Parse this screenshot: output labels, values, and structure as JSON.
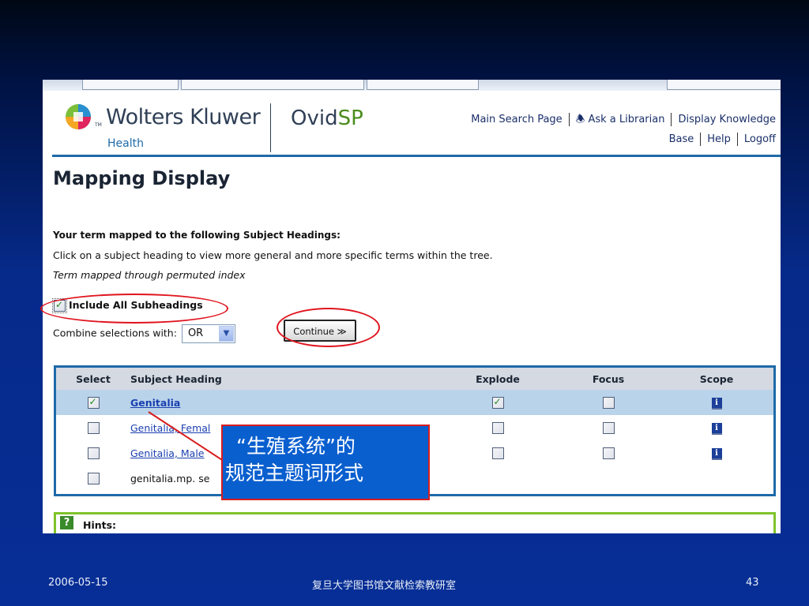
{
  "header": {
    "brand_name": "Wolters Kluwer",
    "brand_tm": "TM",
    "brand_sub": "Health",
    "product_prefix": "Ovid",
    "product_suffix": "SP"
  },
  "nav": {
    "main_search": "Main Search Page",
    "ask_librarian": "Ask a Librarian",
    "display_knowledge": "Display Knowledge",
    "base": "Base",
    "help": "Help",
    "logoff": "Logoff"
  },
  "page": {
    "title": "Mapping Display",
    "mapped_heading": "Your term mapped to the following Subject Headings:",
    "instruction": "Click on a subject heading to view more general and more specific terms within the tree.",
    "permuted_note": "Term mapped through permuted index",
    "include_subheadings_label": "Include All Subheadings",
    "include_subheadings_checked": true,
    "combine_label": "Combine selections with:",
    "combine_value": "OR",
    "continue_label": "Continue ≫"
  },
  "table": {
    "columns": [
      "Select",
      "Subject Heading",
      "Explode",
      "Focus",
      "Scope"
    ],
    "rows": [
      {
        "heading": "Genitalia",
        "selected": true,
        "explode": true,
        "focus": false,
        "scope_icon": "info-icon",
        "link": true
      },
      {
        "heading": "Genitalia, Femal",
        "selected": false,
        "explode": false,
        "focus": false,
        "scope_icon": "info-icon",
        "link": true
      },
      {
        "heading": "Genitalia, Male",
        "selected": false,
        "explode": false,
        "focus": false,
        "scope_icon": "info-icon",
        "link": true
      },
      {
        "heading": "genitalia.mp. se",
        "selected": false,
        "explode": null,
        "focus": null,
        "scope_icon": null,
        "link": false
      }
    ]
  },
  "hints": {
    "label": "Hints:"
  },
  "annotation": {
    "line1": "“生殖系统”的",
    "line2": "规范主题词形式"
  },
  "footer": {
    "date": "2006-05-15",
    "center": "复旦大学图书馆文献检索教研室",
    "page_number": "43"
  },
  "colors": {
    "slide_background": "#072e96",
    "accent_blue": "#1e6aa8",
    "highlight_row": "#b9d3ea",
    "annotation_fill": "#0a5fcf",
    "annotation_border": "#d91d1d",
    "hints_border": "#7fc32a"
  }
}
